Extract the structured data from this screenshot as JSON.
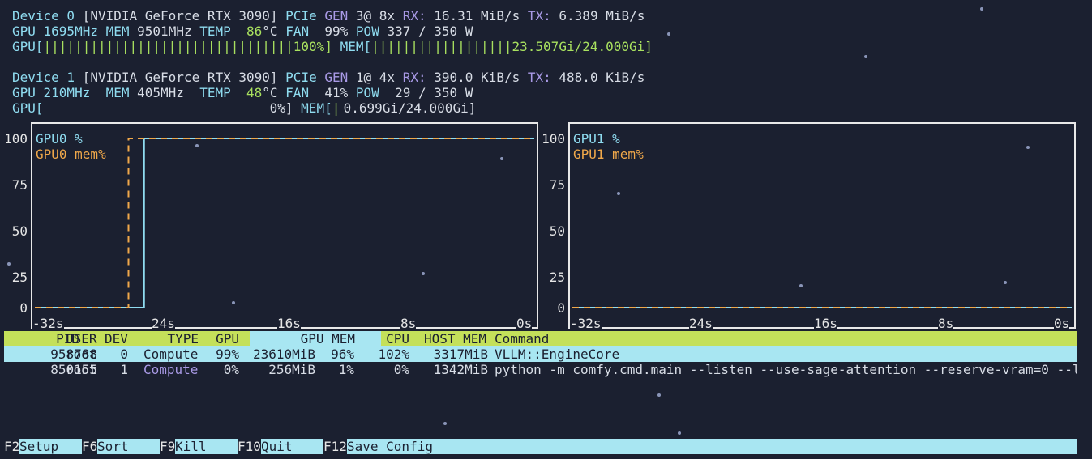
{
  "devices": [
    {
      "line1": {
        "device": "Device 0",
        "model": "[NVIDIA GeForce RTX 3090]",
        "pcie": "PCIe",
        "gen_label": "GEN",
        "gen": "3@ 8x",
        "rx_label": "RX:",
        "rx": "16.31 MiB/s",
        "tx_label": "TX:",
        "tx": "6.389 MiB/s"
      },
      "line2": {
        "gpu": "GPU 1695MHz",
        "mem_label": "MEM",
        "mem": "9501MHz",
        "temp_label": "TEMP",
        "temp": "86",
        "temp_unit": "°C",
        "fan_label": "FAN",
        "fan": "99%",
        "pow_label": "POW",
        "pow": "337 / 350 W"
      },
      "line3": {
        "gpu_label": "GPU[",
        "gpu_bar": "||||||||||||||||||||||||||||||||",
        "gpu_pct": "100%]",
        "mem_label": "MEM[",
        "mem_bar": "||||||||||||||||||",
        "mem_val": "23.507Gi/24.000Gi]"
      }
    },
    {
      "line1": {
        "device": "Device 1",
        "model": "[NVIDIA GeForce RTX 3090]",
        "pcie": "PCIe",
        "gen_label": "GEN",
        "gen": "1@ 4x",
        "rx_label": "RX:",
        "rx": "390.0 KiB/s",
        "tx_label": "TX:",
        "tx": "488.0 KiB/s"
      },
      "line2": {
        "gpu": "GPU 210MHz",
        "mem_label": "MEM",
        "mem": "405MHz",
        "temp_label": "TEMP",
        "temp": "48",
        "temp_unit": "°C",
        "fan_label": "FAN",
        "fan": "41%",
        "pow_label": "POW",
        "pow": "29 / 350 W"
      },
      "line3": {
        "gpu_label": "GPU[",
        "gpu_bar": "",
        "gpu_pct": "0%]",
        "mem_label": "MEM[",
        "mem_bar": "|",
        "mem_val": "0.699Gi/24.000Gi]"
      }
    }
  ],
  "charts": [
    {
      "legend_gpu": "GPU0 %",
      "legend_mem": "GPU0 mem%"
    },
    {
      "legend_gpu": "GPU1 %",
      "legend_mem": "GPU1 mem%"
    }
  ],
  "y_ticks": [
    "100",
    "75",
    "50",
    "25",
    "0"
  ],
  "x_ticks": [
    "-32s",
    "24s",
    "16s",
    "8s",
    "0s"
  ],
  "chart_data": [
    {
      "type": "line",
      "x": [
        -32,
        -27,
        -26,
        -25,
        -24,
        -16,
        -8,
        0
      ],
      "ylim": [
        0,
        100
      ],
      "series": [
        {
          "name": "GPU0 %",
          "color": "#8fdcf0",
          "values": [
            0,
            0,
            0,
            100,
            100,
            100,
            100,
            100
          ]
        },
        {
          "name": "GPU0 mem%",
          "color": "#f0a84a",
          "values": [
            0,
            0,
            100,
            100,
            100,
            100,
            100,
            100
          ]
        }
      ]
    },
    {
      "type": "line",
      "x": [
        -32,
        0
      ],
      "ylim": [
        0,
        100
      ],
      "series": [
        {
          "name": "GPU1 %",
          "color": "#8fdcf0",
          "values": [
            0,
            0
          ]
        },
        {
          "name": "GPU1 mem%",
          "color": "#f0a84a",
          "values": [
            0,
            0
          ]
        }
      ]
    }
  ],
  "processes": {
    "headers": {
      "pid": "PID",
      "user": "USER",
      "dev": "DEV",
      "type": "TYPE",
      "gpu": "GPU",
      "gpu_mem": "GPU MEM",
      "cpu": "CPU",
      "host_mem": "HOST MEM",
      "command": "Command"
    },
    "rows": [
      {
        "pid": "958788",
        "user": "root",
        "dev": "0",
        "type": "Compute",
        "gpu": "99%",
        "gpu_mem": "23610MiB",
        "gpu_mem_pct": "96%",
        "cpu": "102%",
        "host_mem": "3317MiB",
        "command": "VLLM::EngineCore"
      },
      {
        "pid": "850155",
        "user": "root",
        "dev": "1",
        "type": "Compute",
        "gpu": "0%",
        "gpu_mem": "256MiB",
        "gpu_mem_pct": "1%",
        "cpu": "0%",
        "host_mem": "1342MiB",
        "command": "python -m comfy.cmd.main --listen --use-sage-attention --reserve-vram=0 --l"
      }
    ]
  },
  "footer": [
    {
      "key": "F2",
      "label": "Setup"
    },
    {
      "key": "F6",
      "label": "Sort"
    },
    {
      "key": "F9",
      "label": "Kill"
    },
    {
      "key": "F10",
      "label": "Quit"
    },
    {
      "key": "F12",
      "label": "Save Config"
    }
  ],
  "colors": {
    "background": "#1b2030",
    "gpu_line": "#8fdcf0",
    "mem_line": "#f0a84a",
    "header_bar": "#c4e05a",
    "selected_row": "#a8e6f2"
  }
}
